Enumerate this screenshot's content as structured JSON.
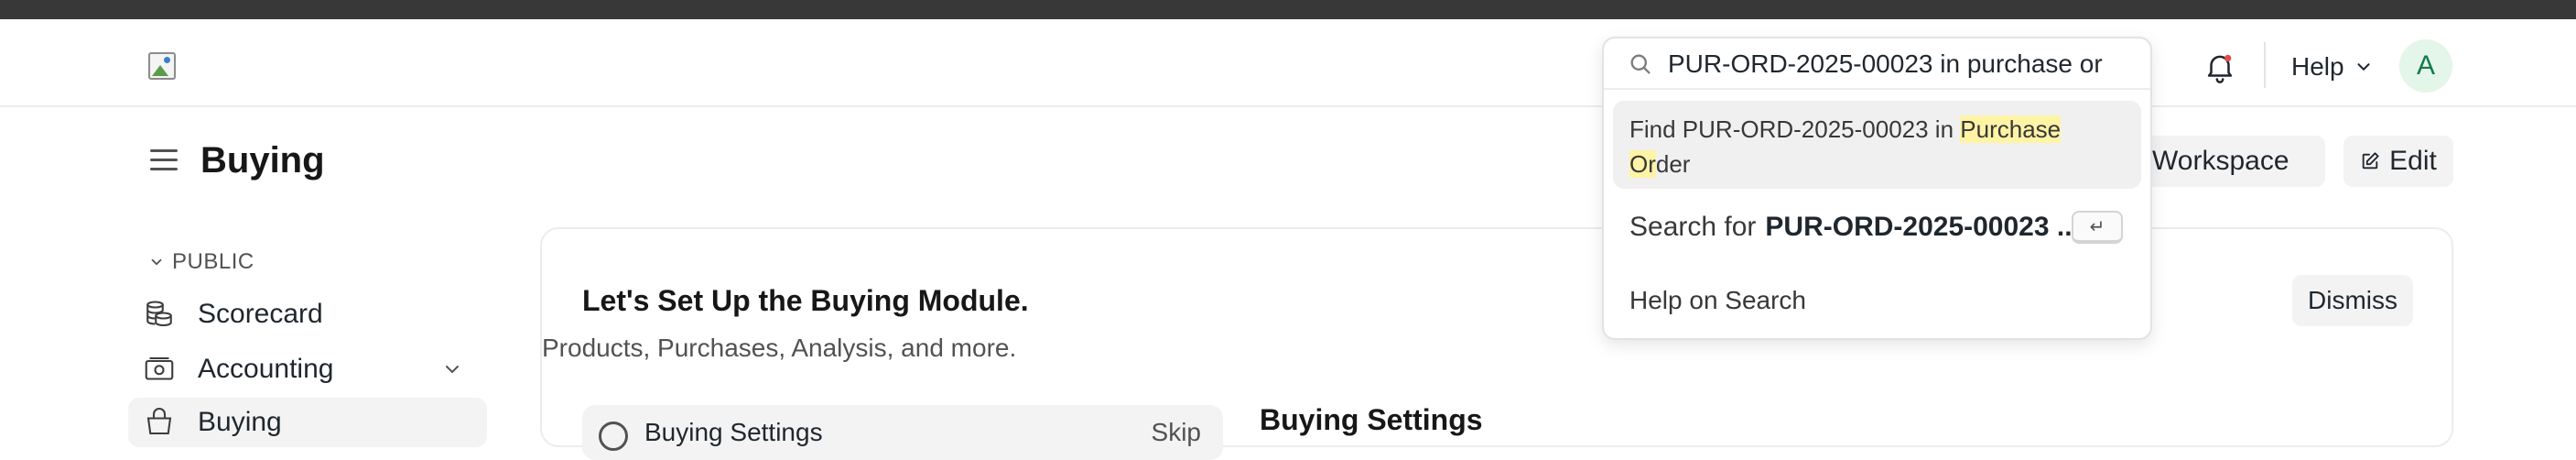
{
  "navbar": {
    "help_label": "Help",
    "avatar_initial": "A"
  },
  "search": {
    "query": "PUR-ORD-2025-00023 in purchase or",
    "results": {
      "find_prefix": "Find PUR-ORD-2025-00023 in ",
      "find_hl_1": "Purchase",
      "find_hl_2": "Or",
      "find_rest": "der",
      "search_for_prefix": "Search for",
      "search_for_term": "PUR-ORD-2025-00023 ...",
      "enter_key": "↵",
      "help_on_search": "Help on Search"
    }
  },
  "page": {
    "title": "Buying",
    "workspace_button": "e Workspace",
    "edit_button": "Edit"
  },
  "sidebar": {
    "section_label": "PUBLIC",
    "items": [
      {
        "label": "Scorecard",
        "icon": "coins-icon"
      },
      {
        "label": "Accounting",
        "icon": "accounting-icon"
      },
      {
        "label": "Buying",
        "icon": "buying-icon"
      }
    ]
  },
  "card": {
    "title": "Let's Set Up the Buying Module.",
    "subtitle": "Products, Purchases, Analysis, and more.",
    "dismiss": "Dismiss",
    "step_label": "Buying Settings",
    "step_action": "Skip",
    "right_heading": "Buying Settings"
  },
  "colors": {
    "top_strip": "#383838",
    "highlight": "#fff3a6",
    "avatar_bg": "#e4f5e9",
    "avatar_fg": "#16794c"
  }
}
